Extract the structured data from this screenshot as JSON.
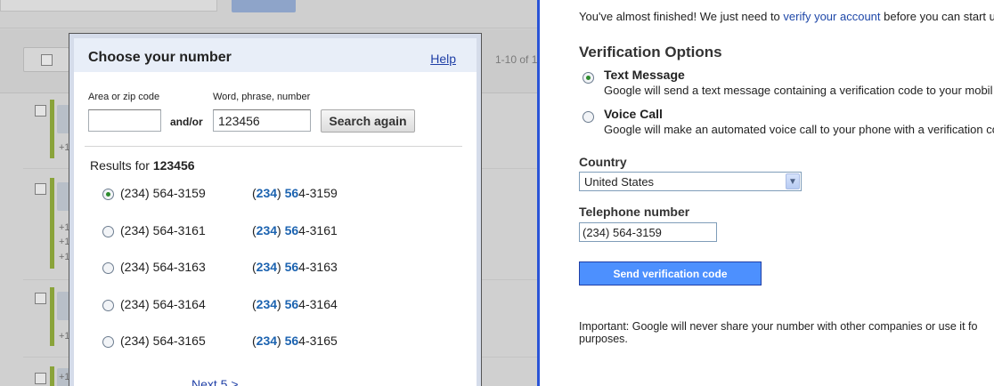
{
  "background_app": {
    "pagination": "1-10 of 1",
    "row_markers": [
      "+1",
      "+1",
      "+1",
      "+1",
      "+1",
      "+1"
    ]
  },
  "dialog": {
    "title": "Choose your number",
    "help": "Help",
    "area_label": "Area or zip code",
    "area_value": "",
    "and_or": "and/or",
    "word_label": "Word, phrase, number",
    "word_value": "123456",
    "search_button": "Search again",
    "results_prefix": "Results for",
    "results_query": "123456",
    "results": [
      {
        "number": "(234) 564-3159",
        "selected": true
      },
      {
        "number": "(234) 564-3161",
        "selected": false
      },
      {
        "number": "(234) 564-3163",
        "selected": false
      },
      {
        "number": "(234) 564-3164",
        "selected": false
      },
      {
        "number": "(234) 564-3165",
        "selected": false
      }
    ],
    "highlight_parts": {
      "a": "234",
      "b": "56"
    },
    "next": "Next 5 >"
  },
  "verification": {
    "intro_before": "You've almost finished! We just need to ",
    "intro_link": "verify your account",
    "intro_after": " before you can start u",
    "heading": "Verification Options",
    "options": [
      {
        "label": "Text Message",
        "desc": "Google will send a text message containing a verification code to your mobil",
        "selected": true
      },
      {
        "label": "Voice Call",
        "desc": "Google will make an automated voice call to your phone with a verification co",
        "selected": false
      }
    ],
    "country_label": "Country",
    "country_value": "United States",
    "phone_label": "Telephone number",
    "phone_value": "(234) 564-3159",
    "send_button": "Send verification code",
    "important": "Important: Google will never share your number with other companies or use it fo purposes."
  }
}
